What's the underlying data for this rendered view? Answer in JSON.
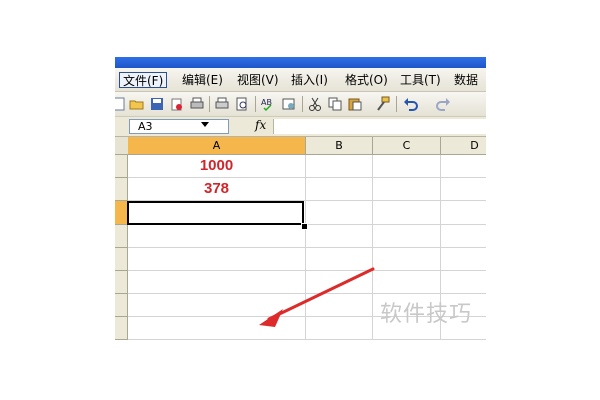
{
  "menu": {
    "items": [
      {
        "label": "文件(F)",
        "active": true
      },
      {
        "label": "编辑(E)"
      },
      {
        "label": "视图(V)"
      },
      {
        "label": "插入(I)"
      },
      {
        "label": "格式(O)"
      },
      {
        "label": "工具(T)"
      },
      {
        "label": "数据"
      }
    ]
  },
  "formula_bar": {
    "name_box": "A3",
    "fx_label": "fx",
    "formula": ""
  },
  "sheet": {
    "columns": [
      "A",
      "B",
      "C",
      "D"
    ],
    "selected_column": "A",
    "cells": {
      "A1": "1000",
      "A2": "378",
      "A3": ""
    },
    "active_cell": "A3"
  },
  "colors": {
    "value_red": "#d0262b",
    "header_selected": "#f5b74b",
    "arrow_red": "#dd2a2a"
  },
  "icons": [
    "copy-icon",
    "open-folder-icon",
    "save-icon",
    "permission-icon",
    "print-icon",
    "print-preview-icon",
    "spelling-icon",
    "research-icon",
    "cut-icon",
    "copy2-icon",
    "paste-icon",
    "format-painter-icon",
    "undo-icon",
    "redo-icon"
  ],
  "watermark": "软件技巧"
}
